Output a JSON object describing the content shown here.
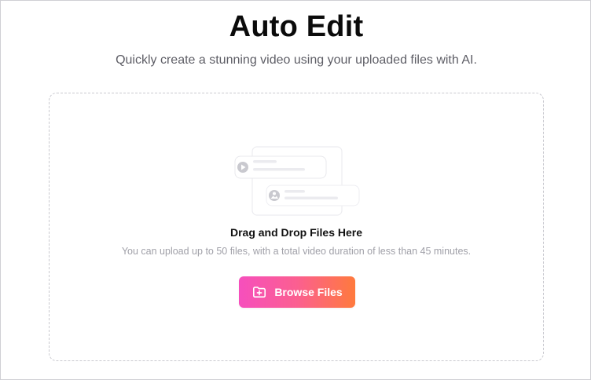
{
  "page": {
    "title": "Auto Edit",
    "subtitle": "Quickly create a stunning video using your uploaded files with AI."
  },
  "dropzone": {
    "heading": "Drag and Drop Files Here",
    "hint": "You can upload up to 50 files, with a total video duration of less than 45 minutes.",
    "illustration_icons": [
      "play-icon",
      "image-icon"
    ],
    "browse_button": {
      "label": "Browse Files",
      "icon": "folder-add-icon",
      "gradient": [
        "#f64fbd",
        "#fb5f90",
        "#ff7a3d"
      ]
    }
  },
  "colors": {
    "title": "#0b0b0b",
    "subtitle": "#5e5e66",
    "hint": "#a0a0a8",
    "dashed_border": "#c9c9cf"
  }
}
